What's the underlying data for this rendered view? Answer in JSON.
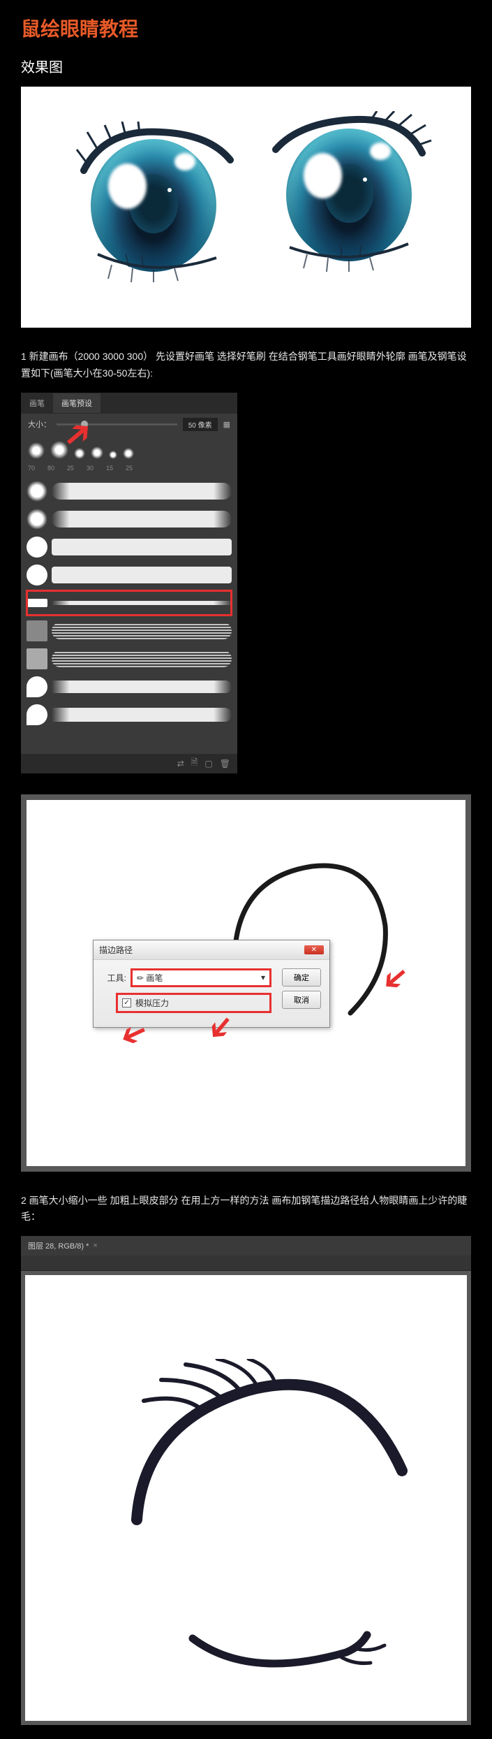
{
  "title": "鼠绘眼睛教程",
  "subtitle": "效果图",
  "step1": "1  新建画布（2000  3000 300）  先设置好画笔  选择好笔刷  在结合钢笔工具画好眼睛外轮廓  画笔及钢笔设置如下(画笔大小在30-50左右):",
  "step2": "2  画笔大小缩小一些  加粗上眼皮部分  在用上方一样的方法  画布加钢笔描边路径给人物眼睛画上少许的睫毛：",
  "panel": {
    "tab1": "画笔",
    "tab2": "画笔预设",
    "size_label": "大小：",
    "size_value": "50 像素",
    "sizes": [
      "70",
      "80",
      "25",
      "30",
      "15",
      "25"
    ]
  },
  "dialog": {
    "title": "描边路径",
    "tool_label": "工具:",
    "tool_value": "画笔",
    "pressure": "模拟压力",
    "ok": "确定",
    "cancel": "取消"
  },
  "c3": {
    "tab": "图层 28, RGB/8) *"
  }
}
